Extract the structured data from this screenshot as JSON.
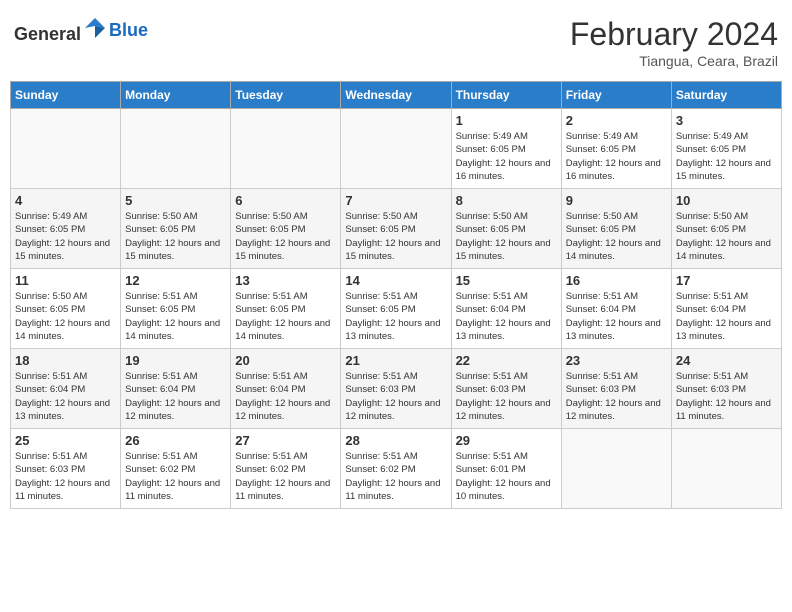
{
  "header": {
    "logo_general": "General",
    "logo_blue": "Blue",
    "title": "February 2024",
    "subtitle": "Tiangua, Ceara, Brazil"
  },
  "weekdays": [
    "Sunday",
    "Monday",
    "Tuesday",
    "Wednesday",
    "Thursday",
    "Friday",
    "Saturday"
  ],
  "weeks": [
    [
      {
        "day": "",
        "info": ""
      },
      {
        "day": "",
        "info": ""
      },
      {
        "day": "",
        "info": ""
      },
      {
        "day": "",
        "info": ""
      },
      {
        "day": "1",
        "info": "Sunrise: 5:49 AM\nSunset: 6:05 PM\nDaylight: 12 hours\nand 16 minutes."
      },
      {
        "day": "2",
        "info": "Sunrise: 5:49 AM\nSunset: 6:05 PM\nDaylight: 12 hours\nand 16 minutes."
      },
      {
        "day": "3",
        "info": "Sunrise: 5:49 AM\nSunset: 6:05 PM\nDaylight: 12 hours\nand 15 minutes."
      }
    ],
    [
      {
        "day": "4",
        "info": "Sunrise: 5:49 AM\nSunset: 6:05 PM\nDaylight: 12 hours\nand 15 minutes."
      },
      {
        "day": "5",
        "info": "Sunrise: 5:50 AM\nSunset: 6:05 PM\nDaylight: 12 hours\nand 15 minutes."
      },
      {
        "day": "6",
        "info": "Sunrise: 5:50 AM\nSunset: 6:05 PM\nDaylight: 12 hours\nand 15 minutes."
      },
      {
        "day": "7",
        "info": "Sunrise: 5:50 AM\nSunset: 6:05 PM\nDaylight: 12 hours\nand 15 minutes."
      },
      {
        "day": "8",
        "info": "Sunrise: 5:50 AM\nSunset: 6:05 PM\nDaylight: 12 hours\nand 15 minutes."
      },
      {
        "day": "9",
        "info": "Sunrise: 5:50 AM\nSunset: 6:05 PM\nDaylight: 12 hours\nand 14 minutes."
      },
      {
        "day": "10",
        "info": "Sunrise: 5:50 AM\nSunset: 6:05 PM\nDaylight: 12 hours\nand 14 minutes."
      }
    ],
    [
      {
        "day": "11",
        "info": "Sunrise: 5:50 AM\nSunset: 6:05 PM\nDaylight: 12 hours\nand 14 minutes."
      },
      {
        "day": "12",
        "info": "Sunrise: 5:51 AM\nSunset: 6:05 PM\nDaylight: 12 hours\nand 14 minutes."
      },
      {
        "day": "13",
        "info": "Sunrise: 5:51 AM\nSunset: 6:05 PM\nDaylight: 12 hours\nand 14 minutes."
      },
      {
        "day": "14",
        "info": "Sunrise: 5:51 AM\nSunset: 6:05 PM\nDaylight: 12 hours\nand 13 minutes."
      },
      {
        "day": "15",
        "info": "Sunrise: 5:51 AM\nSunset: 6:04 PM\nDaylight: 12 hours\nand 13 minutes."
      },
      {
        "day": "16",
        "info": "Sunrise: 5:51 AM\nSunset: 6:04 PM\nDaylight: 12 hours\nand 13 minutes."
      },
      {
        "day": "17",
        "info": "Sunrise: 5:51 AM\nSunset: 6:04 PM\nDaylight: 12 hours\nand 13 minutes."
      }
    ],
    [
      {
        "day": "18",
        "info": "Sunrise: 5:51 AM\nSunset: 6:04 PM\nDaylight: 12 hours\nand 13 minutes."
      },
      {
        "day": "19",
        "info": "Sunrise: 5:51 AM\nSunset: 6:04 PM\nDaylight: 12 hours\nand 12 minutes."
      },
      {
        "day": "20",
        "info": "Sunrise: 5:51 AM\nSunset: 6:04 PM\nDaylight: 12 hours\nand 12 minutes."
      },
      {
        "day": "21",
        "info": "Sunrise: 5:51 AM\nSunset: 6:03 PM\nDaylight: 12 hours\nand 12 minutes."
      },
      {
        "day": "22",
        "info": "Sunrise: 5:51 AM\nSunset: 6:03 PM\nDaylight: 12 hours\nand 12 minutes."
      },
      {
        "day": "23",
        "info": "Sunrise: 5:51 AM\nSunset: 6:03 PM\nDaylight: 12 hours\nand 12 minutes."
      },
      {
        "day": "24",
        "info": "Sunrise: 5:51 AM\nSunset: 6:03 PM\nDaylight: 12 hours\nand 11 minutes."
      }
    ],
    [
      {
        "day": "25",
        "info": "Sunrise: 5:51 AM\nSunset: 6:03 PM\nDaylight: 12 hours\nand 11 minutes."
      },
      {
        "day": "26",
        "info": "Sunrise: 5:51 AM\nSunset: 6:02 PM\nDaylight: 12 hours\nand 11 minutes."
      },
      {
        "day": "27",
        "info": "Sunrise: 5:51 AM\nSunset: 6:02 PM\nDaylight: 12 hours\nand 11 minutes."
      },
      {
        "day": "28",
        "info": "Sunrise: 5:51 AM\nSunset: 6:02 PM\nDaylight: 12 hours\nand 11 minutes."
      },
      {
        "day": "29",
        "info": "Sunrise: 5:51 AM\nSunset: 6:01 PM\nDaylight: 12 hours\nand 10 minutes."
      },
      {
        "day": "",
        "info": ""
      },
      {
        "day": "",
        "info": ""
      }
    ]
  ]
}
